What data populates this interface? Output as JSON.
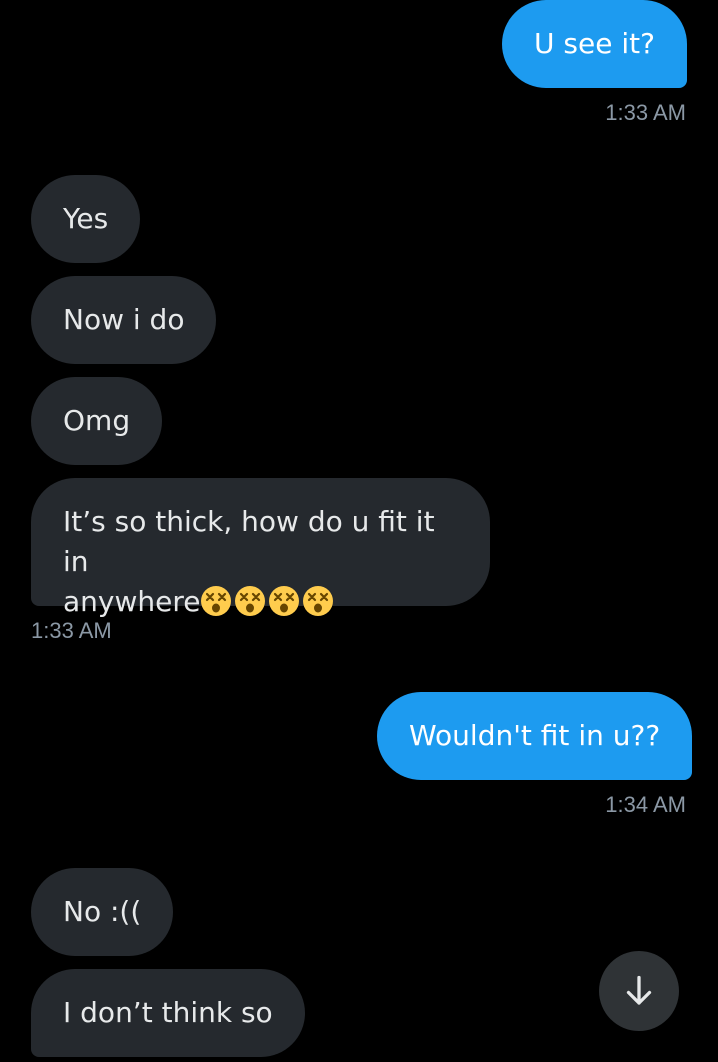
{
  "messages": [
    {
      "text": "U see it?",
      "direction": "sent"
    },
    {
      "text": "Yes",
      "direction": "received"
    },
    {
      "text": "Now i do",
      "direction": "received"
    },
    {
      "text": "Omg",
      "direction": "received"
    },
    {
      "text": "It’s so thick, how do u fit it in",
      "text_line2": "anywhere",
      "emoji_count": 4,
      "emoji": "dizzy-face",
      "direction": "received"
    },
    {
      "text": "Wouldn't fit in u??",
      "direction": "sent"
    },
    {
      "text": "No :((",
      "direction": "received"
    },
    {
      "text": "I don’t think so",
      "direction": "received"
    }
  ],
  "timestamps": [
    "1:33 AM",
    "1:33 AM",
    "1:34 AM"
  ],
  "scroll_button": {
    "icon": "arrow-down-icon"
  },
  "colors": {
    "background": "#000000",
    "sent_bubble": "#1d9bf0",
    "received_bubble": "#25292e",
    "timestamp": "#8b98a5",
    "text": "#e7e9ea"
  }
}
